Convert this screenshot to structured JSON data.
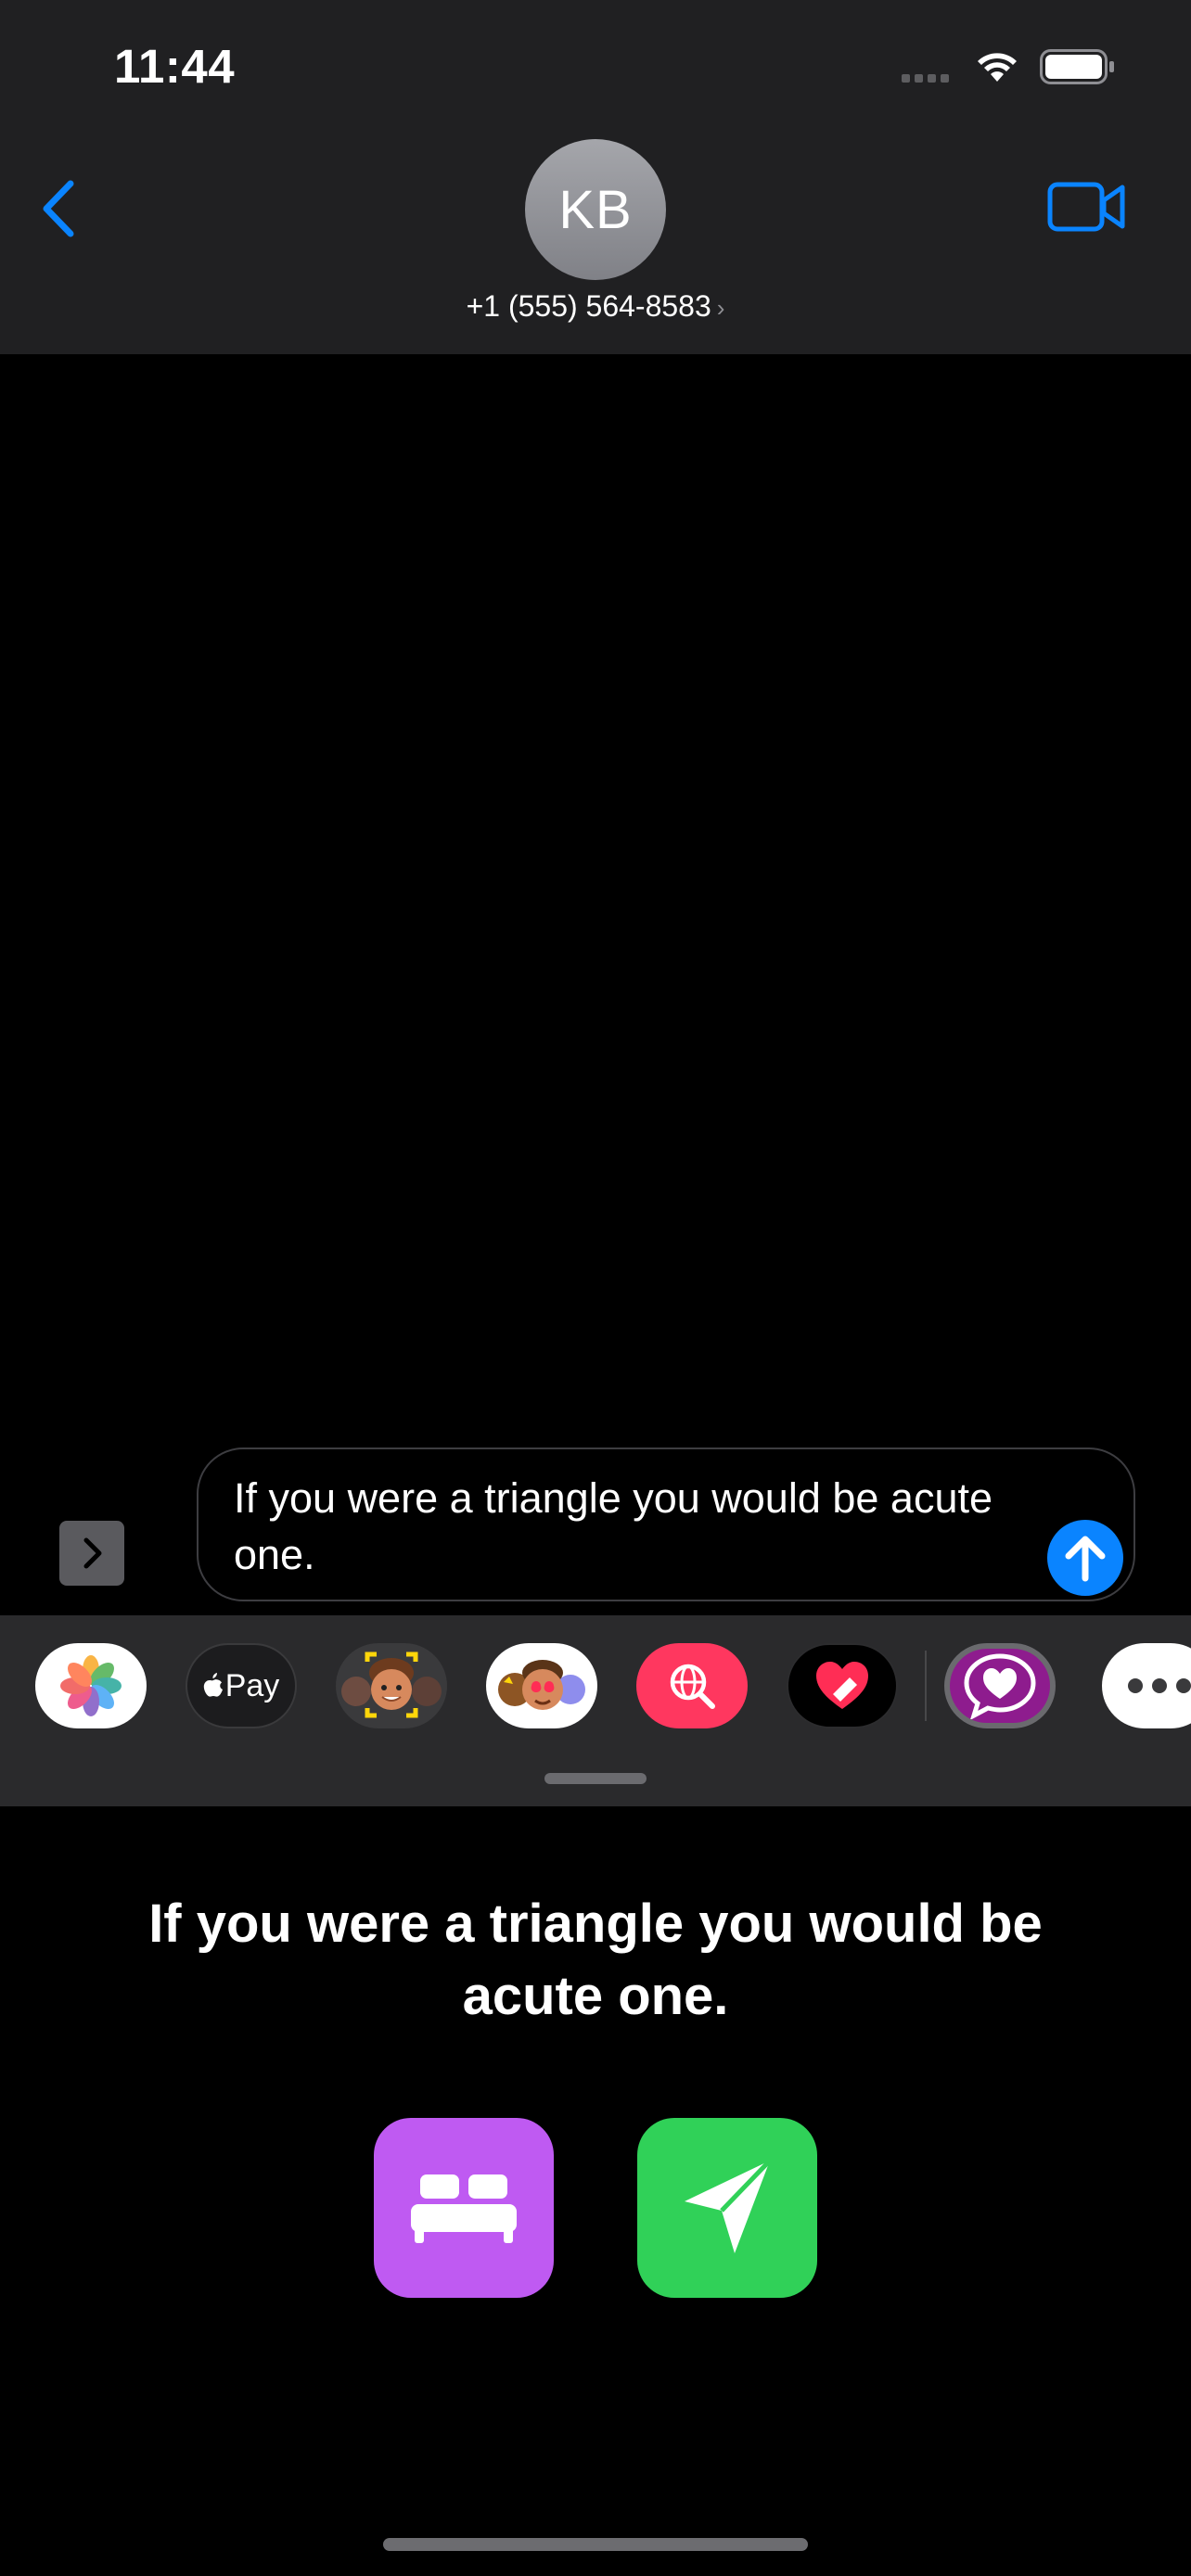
{
  "status_bar": {
    "time": "11:44"
  },
  "header": {
    "avatar_initials": "KB",
    "contact_phone": "+1 (555) 564-8583",
    "accent_color": "#0a84ff"
  },
  "composer": {
    "text": "If you were a triangle you would be acute one.",
    "send_color": "#0a84ff"
  },
  "app_drawer": {
    "apps": [
      {
        "name": "photos-app",
        "icon": "photos-flower-icon"
      },
      {
        "name": "apple-pay-app",
        "label": "Pay",
        "icon": "apple-logo-icon"
      },
      {
        "name": "memoji-camera-app",
        "icon": "memoji-face-icon"
      },
      {
        "name": "memoji-stickers-app",
        "icon": "memoji-stickers-icon"
      },
      {
        "name": "image-search-app",
        "icon": "globe-search-icon",
        "color": "#ff375f"
      },
      {
        "name": "digital-touch-app",
        "icon": "heart-touch-icon"
      },
      {
        "name": "love-messages-app",
        "icon": "heart-speech-bubble-icon",
        "color": "#8e1c8e"
      },
      {
        "name": "more-apps",
        "icon": "ellipsis-icon"
      }
    ]
  },
  "extension_panel": {
    "message": "If you were a triangle you would be acute one.",
    "buttons": [
      {
        "name": "bed-button",
        "icon": "bed-icon",
        "color": "#bf5af2"
      },
      {
        "name": "send-message-button",
        "icon": "paper-plane-icon",
        "color": "#30d158"
      }
    ]
  }
}
